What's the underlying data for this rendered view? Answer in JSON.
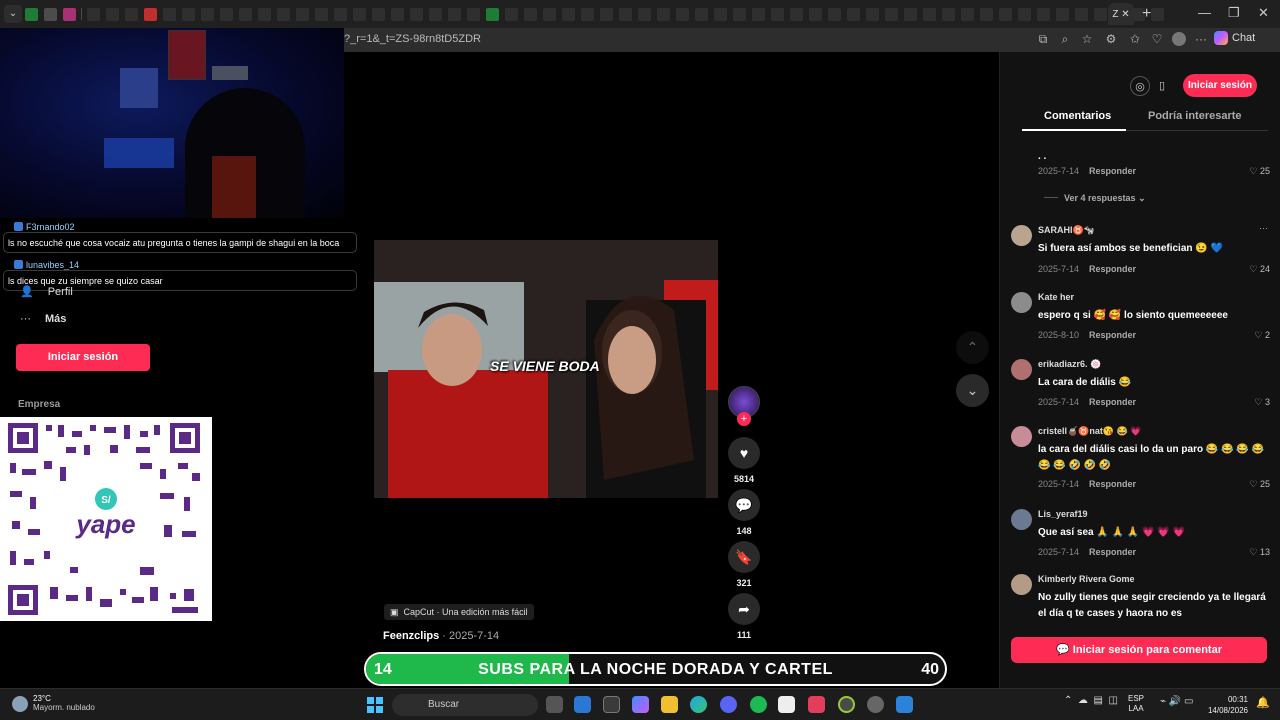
{
  "browser": {
    "url": "?_r=1&_t=ZS-98rn8tD5ZDR",
    "active_tab_label": "Z",
    "chat_label": "Chat"
  },
  "stream_chat": [
    {
      "user": "F3rnando02",
      "message": "ls no escuché que cosa vocaiz atu pregunta o tienes la gampi de shagui en la boca"
    },
    {
      "user": "lunavibes_14",
      "message": "ls dices que zu siempre se quizo casar"
    }
  ],
  "sidebar": {
    "perfil": "Perfil",
    "mas": "Más",
    "login": "Iniciar sesión",
    "empresa": "Empresa"
  },
  "qr": {
    "brand": "yape"
  },
  "video": {
    "caption": "SE VIENE BODA",
    "capcut": "CapCut · Una edición más fácil",
    "author": "Feenzclips",
    "date": "· 2025-7-14",
    "likes": "5814",
    "comments": "148",
    "saves": "321",
    "shares": "111"
  },
  "panel": {
    "login": "Iniciar sesión",
    "tab_comments": "Comentarios",
    "tab_related": "Podría interesarte",
    "view_replies": "Ver 4 respuestas",
    "comment_login": "Iniciar sesión para comentar",
    "reply_label": "Responder"
  },
  "comments": [
    {
      "user": "",
      "text": ".                                   .",
      "date": "2025-7-14",
      "likes": "25"
    },
    {
      "user": "SARAHI♉🐄",
      "text": "Si fuera así ambos se benefician 😉 💙",
      "date": "2025-7-14",
      "likes": "24"
    },
    {
      "user": "Kate her",
      "text": "espero q si 🥰 🥰  lo siento quemeeeeee",
      "date": "2025-8-10",
      "likes": "2"
    },
    {
      "user": "erikadiazr6. 🍥",
      "text": "La cara de diális 😂",
      "date": "2025-7-14",
      "likes": "3"
    },
    {
      "user": "cristell🧉♉nat😘 😂 💗",
      "text": "la cara del diális casi lo da un paro 😂 😂 😂 😂 😂 😂 🤣 🤣 🤣",
      "date": "2025-7-14",
      "likes": "25"
    },
    {
      "user": "Lis_yeraf19",
      "text": "Que así sea 🙏 🙏 🙏 💗 💗 💗",
      "date": "2025-7-14",
      "likes": "13"
    },
    {
      "user": "Kimberly Rivera Gome",
      "text": "No zully tienes que segir creciendo ya te llegará el día q te cases y haora no es",
      "date": "",
      "likes": ""
    }
  ],
  "goal": {
    "current": "14",
    "target": "40",
    "label": "SUBS PARA LA NOCHE DORADA Y CARTEL",
    "progress": 0.35,
    "color": "#1fb84a"
  },
  "taskbar": {
    "temp": "23°C",
    "weather": "Mayorm. nublado",
    "search": "Buscar",
    "lang_top": "ESP",
    "lang_bottom": "LAA",
    "time": "00:31",
    "date": "14/08/2026"
  },
  "colors": {
    "accent": "#fe2c55",
    "panel": "#121212"
  }
}
